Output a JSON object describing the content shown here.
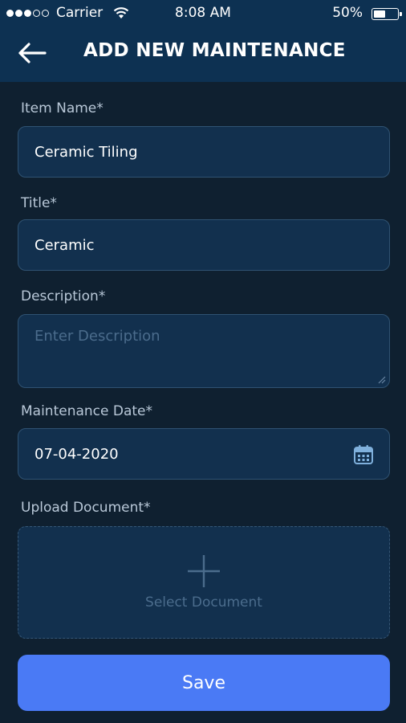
{
  "status_bar": {
    "carrier": "Carrier",
    "time": "8:08 AM",
    "battery": "50%"
  },
  "header": {
    "title": "ADD NEW MAINTENANCE",
    "back_icon": "arrow-left-icon"
  },
  "form": {
    "item_name": {
      "label": "Item Name*",
      "value": "Ceramic Tiling"
    },
    "title": {
      "label": "Title*",
      "value": "Ceramic"
    },
    "description": {
      "label": "Description*",
      "placeholder": "Enter Description"
    },
    "maintenance_date": {
      "label": "Maintenance Date*",
      "value": "07-04-2020",
      "icon": "calendar-icon"
    },
    "upload_document": {
      "label": "Upload Document*",
      "select_text": "Select Document",
      "icon": "plus-icon"
    }
  },
  "save_label": "Save",
  "colors": {
    "background": "#0f2030",
    "header": "#0d3152",
    "field": "#12304e",
    "accent": "#4a7af5"
  }
}
